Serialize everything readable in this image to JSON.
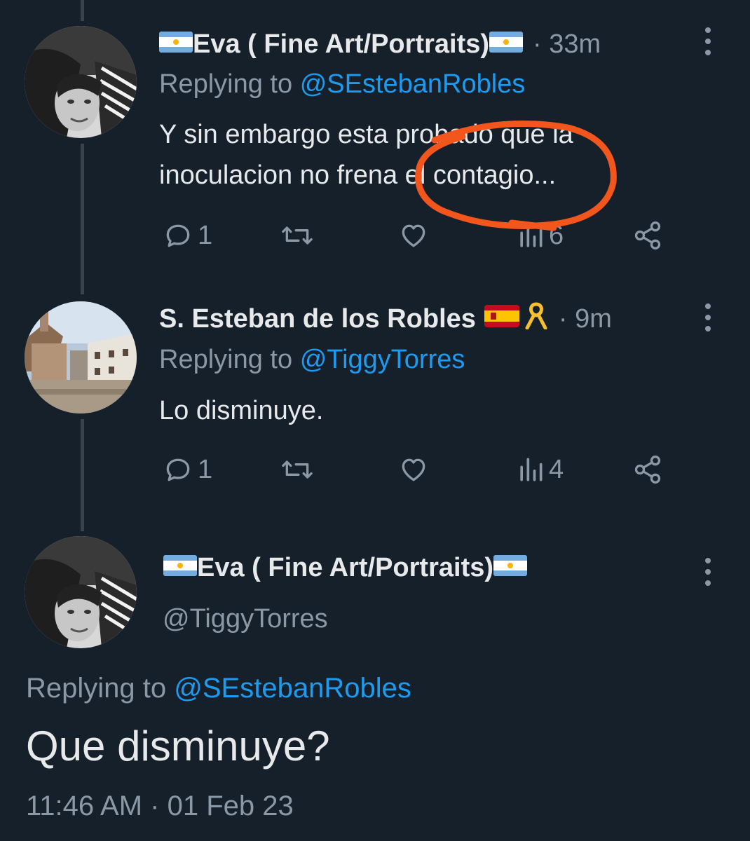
{
  "tweets": [
    {
      "name": "Eva ( Fine Art/Portraits)",
      "time": "33m",
      "replying_prefix": "Replying to",
      "replying_handle": "@SEstebanRobles",
      "text_line1": "Y sin embargo esta probado que la",
      "text_line2": "inoculacion no frena el contagio...",
      "replies": "1",
      "views": "6",
      "flags": [
        "argentina-flag",
        "argentina-flag"
      ]
    },
    {
      "name": "S. Esteban de los Robles",
      "time": "9m",
      "replying_prefix": "Replying to",
      "replying_handle": "@TiggyTorres",
      "text": "Lo disminuye.",
      "replies": "1",
      "views": "4",
      "flags": [
        "spain-flag",
        "yellow-ribbon"
      ]
    }
  ],
  "main_tweet": {
    "name": "Eva ( Fine Art/Portraits)",
    "handle": "@TiggyTorres",
    "replying_prefix": "Replying to",
    "replying_handle": "@SEstebanRobles",
    "text": "Que disminuye?",
    "timestamp": "11:46 AM · 01 Feb 23"
  },
  "icons": [
    "reply-icon",
    "retweet-icon",
    "like-icon",
    "views-icon",
    "share-icon",
    "more-icon"
  ],
  "colors": {
    "background": "#15202b",
    "text": "#e7e9ea",
    "muted": "#8b98a5",
    "link": "#1d9bf0",
    "thread_line": "#38444d",
    "annotation": "#f2561d"
  }
}
